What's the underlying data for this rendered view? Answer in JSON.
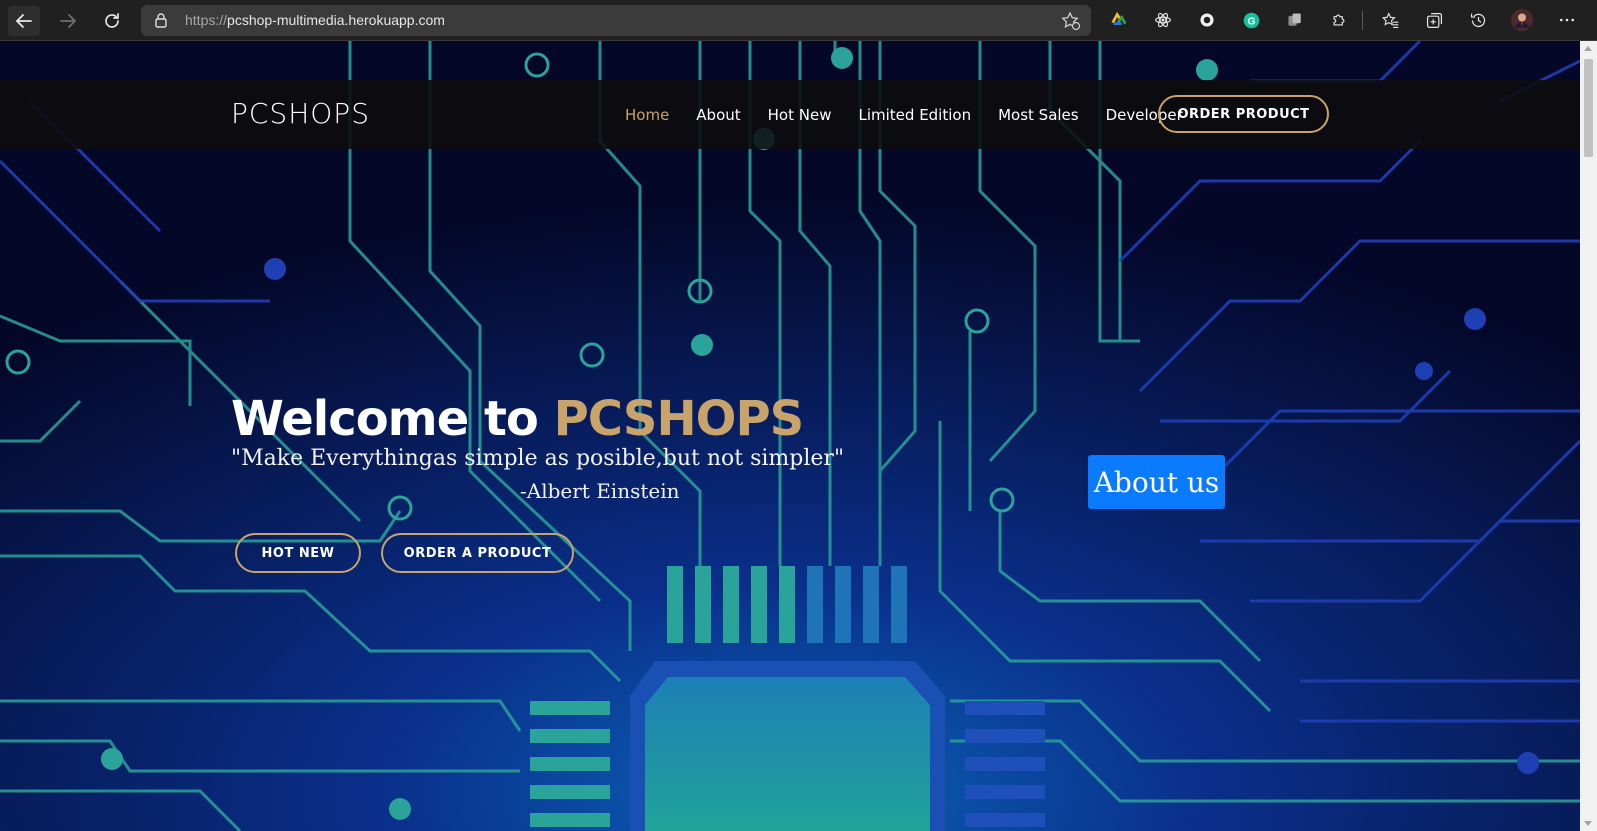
{
  "browser": {
    "url_prefix": "https://",
    "url_host": "pcshop-multimedia.herokuapp.com",
    "icons": {
      "back": "arrow-left-icon",
      "forward": "arrow-right-icon",
      "refresh": "refresh-icon",
      "lock": "lock-icon",
      "add_favorite": "star-add-icon",
      "favorites": "favorites-icon",
      "collections": "collections-icon",
      "history": "history-icon",
      "profile": "avatar",
      "more": "more-icon"
    }
  },
  "site": {
    "logo": "PCSHOPS",
    "menu": [
      {
        "label": "Home",
        "active": true
      },
      {
        "label": "About",
        "active": false
      },
      {
        "label": "Hot New",
        "active": false
      },
      {
        "label": "Limited Edition",
        "active": false
      },
      {
        "label": "Most Sales",
        "active": false
      },
      {
        "label": "Developer",
        "active": false
      }
    ],
    "order_button": "ORDER PRODUCT",
    "accent_color": "#c9a46a"
  },
  "hero": {
    "title_prefix": "Welcome to ",
    "title_brand": "PCSHOPS",
    "quote": "\"Make Everythingas simple as posible,but not simpler\"",
    "author": "-Albert Einstein",
    "buttons": [
      "HOT NEW",
      "ORDER A PRODUCT"
    ],
    "about_button": "About us",
    "about_color": "#0a7bff"
  }
}
